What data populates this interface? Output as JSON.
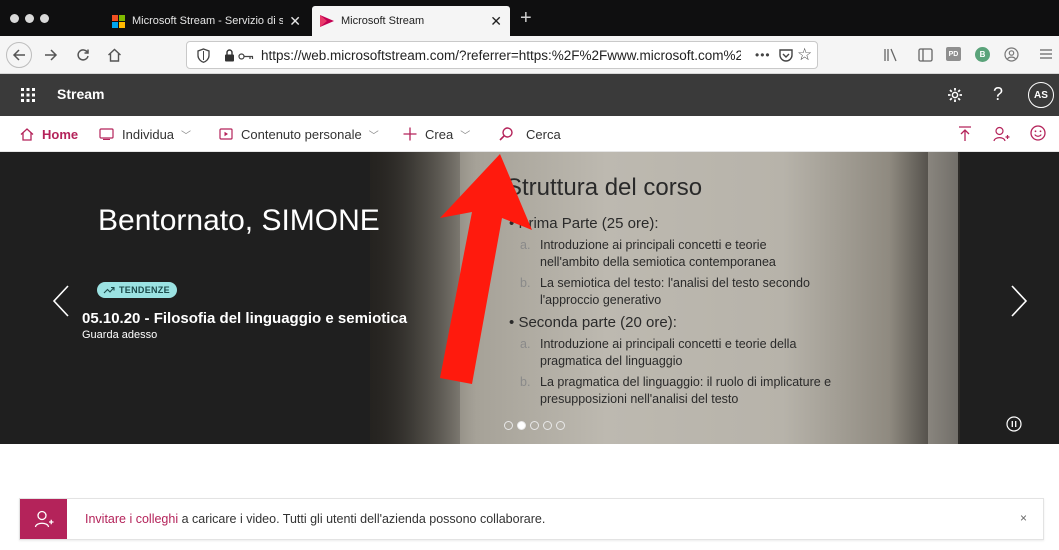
{
  "browser": {
    "tabs": [
      {
        "label": "Microsoft Stream - Servizio di s",
        "close": "✕",
        "active": false
      },
      {
        "label": "Microsoft Stream",
        "close": "✕",
        "active": true
      }
    ],
    "new_tab": "+",
    "url": "https://web.microsoftstream.com/?referrer=https:%2F%2Fwww.microsoft.com%2",
    "url_more": "•••",
    "pd_badge": "PD",
    "ext_badge": "B"
  },
  "app": {
    "name": "Stream",
    "help": "?",
    "avatar": "AS"
  },
  "menu": {
    "home": "Home",
    "discover": "Individua",
    "my_content": "Contenuto personale",
    "create": "Crea",
    "search": "Cerca"
  },
  "hero": {
    "welcome": "Bentornato, SIMONE",
    "badge": "TENDENZE",
    "video_title": "05.10.20 - Filosofia del linguaggio e semiotica",
    "watch_now": "Guarda adesso",
    "slide": {
      "title": "Struttura del corso",
      "part1": "Prima Parte (25 ore):",
      "item_a1": "Introduzione ai principali concetti e teorie",
      "item_a1_cont": "nell'ambito della semiotica contemporanea",
      "item_b1": "La semiotica del testo: l'analisi del testo secondo",
      "item_b1_cont": "l'approccio generativo",
      "part2": "Seconda parte (20 ore):",
      "item_a2": "Introduzione ai principali concetti e teorie della",
      "item_a2_cont": "pragmatica del linguaggio",
      "item_b2": "La pragmatica del linguaggio: il ruolo di implicature e",
      "item_b2_cont": "presupposizioni nell'analisi del testo",
      "marker_a": "a.",
      "marker_b": "b.",
      "bullet": "•"
    },
    "carousel_total": 5,
    "carousel_active": 2
  },
  "banner": {
    "link": "Invitare i colleghi",
    "text": " a caricare i video. Tutti gli utenti dell'azienda possono collaborare.",
    "close": "×"
  },
  "colors": {
    "accent": "#b4235a",
    "header_bg": "#3a3a3a",
    "badge_bg": "#9be2e2",
    "annotation_arrow": "#ff1a0d"
  },
  "icons": {
    "back": "arrow-left-icon",
    "forward": "arrow-right-icon",
    "reload": "reload-icon",
    "home": "home-icon",
    "shield": "shield-icon",
    "lock": "lock-icon",
    "pocket": "pocket-icon",
    "star": "star-icon",
    "library": "library-icon",
    "sidebar": "sidebar-icon",
    "account": "account-icon",
    "menu": "hamburger-icon",
    "waffle": "app-launcher-icon",
    "gear": "gear-icon",
    "upload": "upload-icon",
    "add_person": "add-person-icon",
    "smiley": "smiley-icon",
    "chevron_left": "chevron-left-icon",
    "chevron_right": "chevron-right-icon",
    "pause": "pause-icon",
    "trend": "trend-icon"
  }
}
